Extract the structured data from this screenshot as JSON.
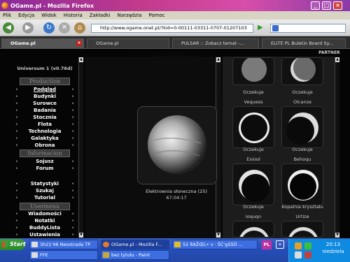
{
  "window": {
    "title": "OGame.pl - Mozilla Firefox",
    "min": "_",
    "max": "□",
    "close": "×"
  },
  "menu": [
    "Plik",
    "Edycja",
    "Widok",
    "Historia",
    "Zakładki",
    "Narzędzia",
    "Pomoc"
  ],
  "url": "http://www.ogame.onet.pl/?kid=0-00111-03311-0707-01207103",
  "tabs": [
    "OGame.pl",
    "OGame.pl",
    "PULSAR :: Zobacz temat -...",
    "ELITE PL Buletin Board Sy..."
  ],
  "partner": "PARTNER",
  "sidebar": {
    "universe": "Universum 1 (v0.76d)",
    "headers": [
      "Production",
      "Informacion",
      "Usermenu"
    ],
    "items": [
      "Podgląd",
      "Budynki",
      "Surowce",
      "Badania",
      "Stocznia",
      "Flota",
      "Technologia",
      "Galaktyka",
      "Obrona",
      "Sojusz",
      "Forum",
      "Statystyki",
      "Szukaj",
      "Tutorial",
      "Wiadomości",
      "Notatki",
      "BuddyLista",
      "Ustawienia"
    ]
  },
  "main": {
    "caption": "Elektrownia słoneczna (25)",
    "timer": "67:04:17"
  },
  "tiles": {
    "labels": [
      "Oczekuje",
      "Oczekuje",
      "Oczekuje",
      "Oczekuje",
      "Oczekuje",
      "Kopalnia kryształu"
    ],
    "names": [
      "Vequess",
      "Olcanze",
      "Exiool",
      "Behoqu",
      "Ioquqn",
      "Urtize"
    ]
  },
  "taskbar": {
    "start": "Start",
    "tasks": [
      "3h21'46 Neostrada TP",
      "OGame.pl - Mozilla F...",
      "52 ϐAŽŒL• v · ŠĆ'gŚŚÖ ...",
      "FFE",
      "bez tytułu - Paint"
    ],
    "lang": "PL",
    "time": "20:13",
    "day": "niedziela"
  }
}
